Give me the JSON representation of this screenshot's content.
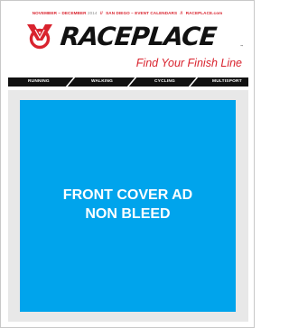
{
  "header": {
    "date_range": "NOVEMBER – DECEMBER",
    "year": "2014",
    "separator": "//",
    "edition": "SAN DIEGO – EVENT CALENDARS",
    "website": "RACEPLACE.com"
  },
  "brand": {
    "name": "RACEPLACE",
    "trademark": "™",
    "tagline": "Find Your Finish Line",
    "logo_icon": "raceplace-v-ring-icon"
  },
  "nav": {
    "items": [
      "RUNNING",
      "WALKING",
      "CYCLING",
      "MULTISPORT"
    ]
  },
  "cover_ad": {
    "line1": "FRONT COVER AD",
    "line2": "NON BLEED"
  },
  "colors": {
    "brand_red": "#d9232e",
    "ad_blue": "#00a4ec",
    "nav_black": "#111111",
    "frame_grey": "#e8e8e8"
  }
}
